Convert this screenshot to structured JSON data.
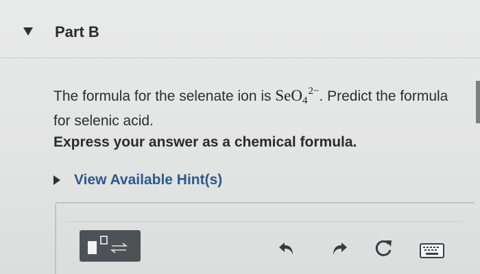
{
  "part": {
    "title": "Part B"
  },
  "question": {
    "text_before": "The formula for the selenate ion is ",
    "formula_base": "SeO",
    "formula_subscript": "4",
    "formula_charge": "2−",
    "text_after": ". Predict the formula for selenic acid."
  },
  "instruction": "Express your answer as a chemical formula.",
  "hint": {
    "label": "View Available Hint(s)"
  },
  "toolbar": {
    "icons": [
      "templates-icon",
      "undo-icon",
      "redo-icon",
      "reset-icon",
      "keyboard-icon"
    ]
  },
  "colors": {
    "background": "#e6e7e7",
    "hint_link": "#2a5a8a",
    "template_button": "#4d5257",
    "icon_dark": "#3a3d40"
  }
}
